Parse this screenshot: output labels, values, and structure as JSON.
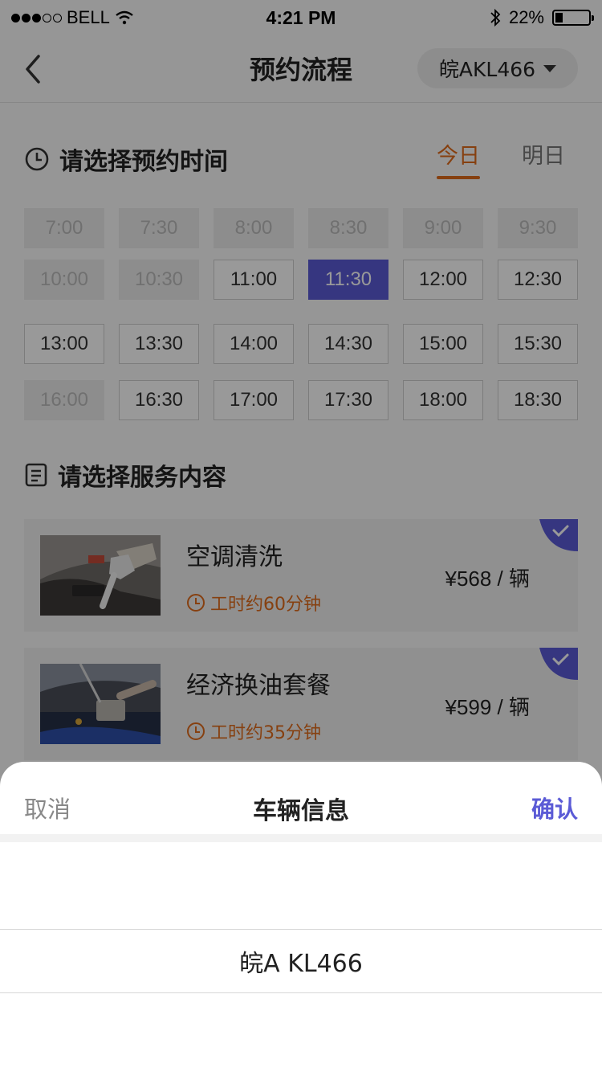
{
  "status_bar": {
    "carrier": "BELL",
    "time": "4:21 PM",
    "battery": "22%"
  },
  "nav": {
    "title": "预约流程",
    "plate": "皖AKL466"
  },
  "time_section": {
    "title": "请选择预约时间",
    "tabs": [
      {
        "label": "今日",
        "active": true
      },
      {
        "label": "明日",
        "active": false
      }
    ],
    "slots": [
      {
        "label": "7:00",
        "state": "disabled"
      },
      {
        "label": "7:30",
        "state": "disabled"
      },
      {
        "label": "8:00",
        "state": "disabled"
      },
      {
        "label": "8:30",
        "state": "disabled"
      },
      {
        "label": "9:00",
        "state": "disabled"
      },
      {
        "label": "9:30",
        "state": "disabled"
      },
      {
        "label": "10:00",
        "state": "disabled"
      },
      {
        "label": "10:30",
        "state": "disabled"
      },
      {
        "label": "11:00",
        "state": "available"
      },
      {
        "label": "11:30",
        "state": "selected"
      },
      {
        "label": "12:00",
        "state": "available"
      },
      {
        "label": "12:30",
        "state": "available"
      },
      {
        "label": "13:00",
        "state": "available"
      },
      {
        "label": "13:30",
        "state": "available"
      },
      {
        "label": "14:00",
        "state": "available"
      },
      {
        "label": "14:30",
        "state": "available"
      },
      {
        "label": "15:00",
        "state": "available"
      },
      {
        "label": "15:30",
        "state": "available"
      },
      {
        "label": "16:00",
        "state": "disabled"
      },
      {
        "label": "16:30",
        "state": "available"
      },
      {
        "label": "17:00",
        "state": "available"
      },
      {
        "label": "17:30",
        "state": "available"
      },
      {
        "label": "18:00",
        "state": "available"
      },
      {
        "label": "18:30",
        "state": "available"
      }
    ]
  },
  "service_section": {
    "title": "请选择服务内容",
    "items": [
      {
        "name": "空调清洗",
        "duration": "工时约60分钟",
        "price": "¥568 / 辆",
        "selected": true
      },
      {
        "name": "经济换油套餐",
        "duration": "工时约35分钟",
        "price": "¥599 / 辆",
        "selected": true
      }
    ]
  },
  "sheet": {
    "cancel": "取消",
    "title": "车辆信息",
    "confirm": "确认",
    "selected_plate": "皖A KL466"
  },
  "colors": {
    "accent": "#5b5bd6",
    "orange": "#e06b1c"
  }
}
